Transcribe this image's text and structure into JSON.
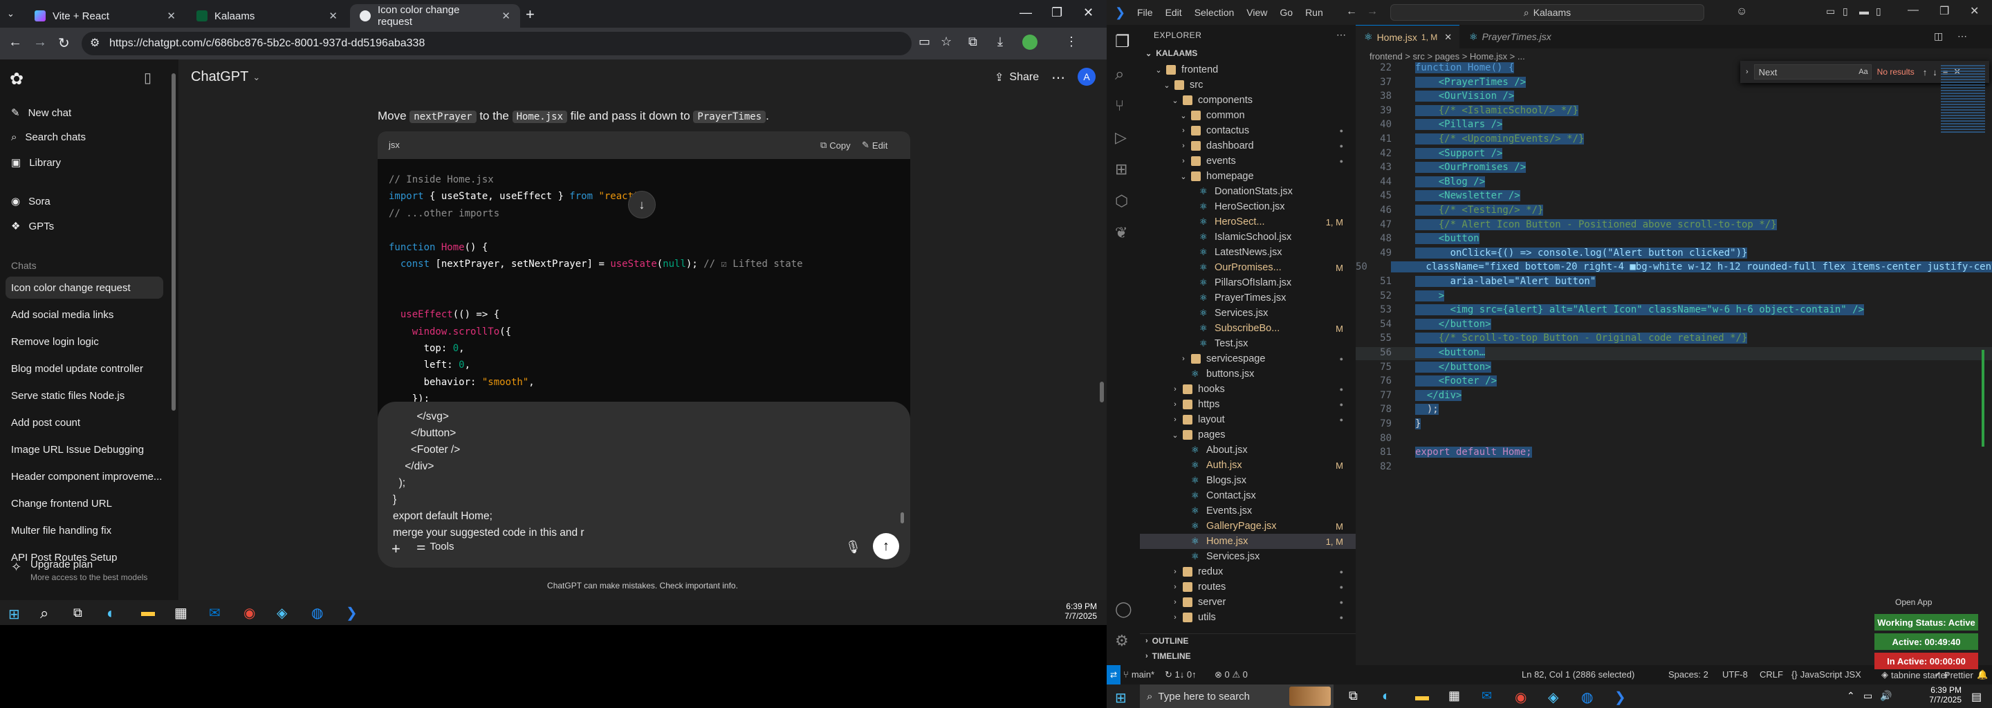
{
  "chrome": {
    "tabs": [
      {
        "title": "Vite + React",
        "color": "#ff6b6b"
      },
      {
        "title": "Kalaams",
        "color": "#e8eaed"
      },
      {
        "title": "Icon color change request",
        "color": "#e8eaed"
      }
    ],
    "url": "https://chatgpt.com/c/686bc876-5b2c-8001-937d-dd5196aba338"
  },
  "chatgpt": {
    "brand": "ChatGPT",
    "nav": [
      {
        "label": "New chat",
        "icon": "edit-icon"
      },
      {
        "label": "Search chats",
        "icon": "search-icon"
      },
      {
        "label": "Library",
        "icon": "library-icon"
      },
      {
        "label": "Sora",
        "icon": "sora-icon"
      },
      {
        "label": "GPTs",
        "icon": "gpts-icon"
      }
    ],
    "chats_header": "Chats",
    "chats": [
      "Icon color change request",
      "Add social media links",
      "Remove login logic",
      "Blog model update controller",
      "Serve static files Node.js",
      "Add post count",
      "Image URL Issue Debugging",
      "Header component improveme...",
      "Change frontend URL",
      "Multer file handling fix",
      "API Post Routes Setup"
    ],
    "upgrade": {
      "title": "Upgrade plan",
      "subtitle": "More access to the best models"
    },
    "share": "Share",
    "message_prefix": "Move ",
    "message_code1": "nextPrayer",
    "message_mid": " to the ",
    "message_code2": "Home.jsx",
    "message_mid2": " file and pass it down to ",
    "message_code3": "PrayerTimes",
    "message_end": ".",
    "code_lang": "jsx",
    "copy": "Copy",
    "edit": "Edit",
    "code_lines": [
      {
        "c": "// Inside Home.jsx"
      },
      {
        "k": "import",
        "p": " { useState, useEffect } ",
        "k2": "from",
        "s": " \"react\"",
        "p2": ";"
      },
      {
        "c": "// ...other imports"
      },
      {
        "blank": ""
      },
      {
        "k": "function",
        "f": " Home",
        "p": "() {"
      },
      {
        "k": "  const",
        "p": " [nextPrayer, setNextPrayer] = ",
        "f": "useState",
        "p2": "(",
        "n": "null",
        "p3": "); ",
        "c": "// ☑ Lifted state"
      },
      {
        "blank": ""
      },
      {
        "blank": ""
      },
      {
        "f": "  useEffect",
        "p": "(() => {"
      },
      {
        "f": "    window.scrollTo",
        "p": "({"
      },
      {
        "p": "      top: ",
        "n": "0",
        "p2": ","
      },
      {
        "p": "      left: ",
        "n": "0",
        "p2": ","
      },
      {
        "p": "      behavior: ",
        "s": "\"smooth\"",
        "p2": ","
      },
      {
        "p": "    });"
      },
      {
        "p": "  }, []);"
      }
    ],
    "composer_lines": [
      "        </svg>",
      "      </button>",
      "      <Footer />",
      "    </div>",
      "  );",
      "}",
      "export default Home;",
      "merge your suggested code in this and r"
    ],
    "tools": "Tools",
    "disclaimer": "ChatGPT can make mistakes. Check important info."
  },
  "taskbar_left": {
    "time": "6:39 PM",
    "date": "7/7/2025"
  },
  "vscode": {
    "menu": [
      "File",
      "Edit",
      "Selection",
      "View",
      "Go",
      "Run"
    ],
    "search": "Kalaams",
    "explorer_title": "EXPLORER",
    "root": "KALAAMS",
    "tree": [
      {
        "depth": 1,
        "name": "frontend",
        "type": "folder",
        "open": true
      },
      {
        "depth": 2,
        "name": "src",
        "type": "folder",
        "open": true
      },
      {
        "depth": 3,
        "name": "components",
        "type": "folder",
        "open": true
      },
      {
        "depth": 4,
        "name": "common",
        "type": "folder",
        "open": true
      },
      {
        "depth": 4,
        "name": "contactus",
        "type": "folder",
        "open": false
      },
      {
        "depth": 4,
        "name": "dashboard",
        "type": "folder",
        "open": false
      },
      {
        "depth": 4,
        "name": "events",
        "type": "folder",
        "open": false
      },
      {
        "depth": 4,
        "name": "homepage",
        "type": "folder",
        "open": true
      },
      {
        "depth": 5,
        "name": "DonationStats.jsx",
        "type": "jsx"
      },
      {
        "depth": 5,
        "name": "HeroSection.jsx",
        "type": "jsx"
      },
      {
        "depth": 5,
        "name": "HeroSect...",
        "type": "jsx",
        "badge": "1, M",
        "mod": true
      },
      {
        "depth": 5,
        "name": "IslamicSchool.jsx",
        "type": "jsx"
      },
      {
        "depth": 5,
        "name": "LatestNews.jsx",
        "type": "jsx"
      },
      {
        "depth": 5,
        "name": "OurPromises...",
        "type": "jsx",
        "badge": "M",
        "mod": true
      },
      {
        "depth": 5,
        "name": "PillarsOfIslam.jsx",
        "type": "jsx"
      },
      {
        "depth": 5,
        "name": "PrayerTimes.jsx",
        "type": "jsx"
      },
      {
        "depth": 5,
        "name": "Services.jsx",
        "type": "jsx"
      },
      {
        "depth": 5,
        "name": "SubscribeBo...",
        "type": "jsx",
        "badge": "M",
        "mod": true
      },
      {
        "depth": 5,
        "name": "Test.jsx",
        "type": "jsx"
      },
      {
        "depth": 4,
        "name": "servicespage",
        "type": "folder",
        "open": false
      },
      {
        "depth": 4,
        "name": "buttons.jsx",
        "type": "jsx"
      },
      {
        "depth": 3,
        "name": "hooks",
        "type": "folder",
        "open": false
      },
      {
        "depth": 3,
        "name": "https",
        "type": "folder",
        "open": false
      },
      {
        "depth": 3,
        "name": "layout",
        "type": "folder",
        "open": false
      },
      {
        "depth": 3,
        "name": "pages",
        "type": "folder",
        "open": true
      },
      {
        "depth": 4,
        "name": "About.jsx",
        "type": "jsx"
      },
      {
        "depth": 4,
        "name": "Auth.jsx",
        "type": "jsx",
        "badge": "M",
        "mod": true
      },
      {
        "depth": 4,
        "name": "Blogs.jsx",
        "type": "jsx"
      },
      {
        "depth": 4,
        "name": "Contact.jsx",
        "type": "jsx"
      },
      {
        "depth": 4,
        "name": "Events.jsx",
        "type": "jsx"
      },
      {
        "depth": 4,
        "name": "GalleryPage.jsx",
        "type": "jsx",
        "badge": "M",
        "mod": true
      },
      {
        "depth": 4,
        "name": "Home.jsx",
        "type": "jsx",
        "badge": "1, M",
        "mod": true,
        "selected": true
      },
      {
        "depth": 4,
        "name": "Services.jsx",
        "type": "jsx"
      },
      {
        "depth": 3,
        "name": "redux",
        "type": "folder",
        "open": false
      },
      {
        "depth": 3,
        "name": "routes",
        "type": "folder",
        "open": false
      },
      {
        "depth": 3,
        "name": "server",
        "type": "folder",
        "open": false
      },
      {
        "depth": 3,
        "name": "utils",
        "type": "folder",
        "open": false
      }
    ],
    "outline": "OUTLINE",
    "timeline": "TIMELINE",
    "tabs": [
      {
        "name": "Home.jsx",
        "badge": "1, M",
        "active": true
      },
      {
        "name": "PrayerTimes.jsx",
        "badge": "",
        "active": false
      }
    ],
    "breadcrumb": "frontend > src > pages > Home.jsx > ...",
    "find_value": "Next",
    "find_result": "No results",
    "code": [
      {
        "n": "22",
        "t": "function Home() {",
        "kind": "fn"
      },
      {
        "n": "37",
        "t": "    <PrayerTimes />",
        "kind": "tag"
      },
      {
        "n": "38",
        "t": "    <OurVision />",
        "kind": "tag"
      },
      {
        "n": "39",
        "t": "    {/* <IslamicSchool/> */}",
        "kind": "com"
      },
      {
        "n": "40",
        "t": "    <Pillars />",
        "kind": "tag"
      },
      {
        "n": "41",
        "t": "    {/* <UpcomingEvents/> */}",
        "kind": "com"
      },
      {
        "n": "42",
        "t": "    <Support />",
        "kind": "tag"
      },
      {
        "n": "43",
        "t": "    <OurPromises />",
        "kind": "tag"
      },
      {
        "n": "44",
        "t": "    <Blog />",
        "kind": "tag"
      },
      {
        "n": "45",
        "t": "    <Newsletter />",
        "kind": "tag"
      },
      {
        "n": "46",
        "t": "    {/* <Testing/> */}",
        "kind": "com"
      },
      {
        "n": "47",
        "t": "    {/* Alert Icon Button - Positioned above scroll-to-top */}",
        "kind": "com"
      },
      {
        "n": "48",
        "t": "    <button",
        "kind": "tag"
      },
      {
        "n": "49",
        "t": "      onClick={() => console.log(\"Alert button clicked\")}",
        "kind": "attr"
      },
      {
        "n": "50",
        "t": "      className=\"fixed bottom-20 right-4 ■bg-white w-12 h-12 rounded-full flex items-center justify-cente",
        "kind": "attr"
      },
      {
        "n": "51",
        "t": "      aria-label=\"Alert button\"",
        "kind": "attr"
      },
      {
        "n": "52",
        "t": "    >",
        "kind": "tag"
      },
      {
        "n": "53",
        "t": "      <img src={alert} alt=\"Alert Icon\" className=\"w-6 h-6 object-contain\" />",
        "kind": "tag"
      },
      {
        "n": "54",
        "t": "    </button>",
        "kind": "tag"
      },
      {
        "n": "55",
        "t": "    {/* Scroll-to-top Button - Original code retained */}",
        "kind": "com"
      },
      {
        "n": "56",
        "t": "    <button…",
        "kind": "tag",
        "fold": true
      },
      {
        "n": "75",
        "t": "    </button>",
        "kind": "tag"
      },
      {
        "n": "76",
        "t": "    <Footer />",
        "kind": "tag"
      },
      {
        "n": "77",
        "t": "  </div>",
        "kind": "tag"
      },
      {
        "n": "78",
        "t": "  );",
        "kind": "plain"
      },
      {
        "n": "79",
        "t": "}",
        "kind": "plain"
      },
      {
        "n": "80",
        "t": "",
        "kind": "plain"
      },
      {
        "n": "81",
        "t": "export default Home;",
        "kind": "export"
      },
      {
        "n": "82",
        "t": "",
        "kind": "plain",
        "unselected": true
      }
    ],
    "status": {
      "branch": "main*",
      "sync": "↻ 1↓ 0↑",
      "problems": "⊗ 0 ⚠ 0",
      "position": "Ln 82, Col 1 (2886 selected)",
      "spaces": "Spaces: 2",
      "encoding": "UTF-8",
      "eol": "CRLF",
      "language": "JavaScript JSX",
      "tabnine": "tabnine starter",
      "prettier": "Prettier"
    },
    "open_app": "Open App",
    "working": [
      {
        "label": "Working Status: Active",
        "color": "#2e7d32"
      },
      {
        "label": "Active: 00:49:40",
        "color": "#2e7d32"
      },
      {
        "label": "In Active: 00:00:00",
        "color": "#c62828"
      }
    ]
  },
  "taskbar_right": {
    "search_placeholder": "Type here to search",
    "time": "6:39 PM",
    "date": "7/7/2025"
  }
}
